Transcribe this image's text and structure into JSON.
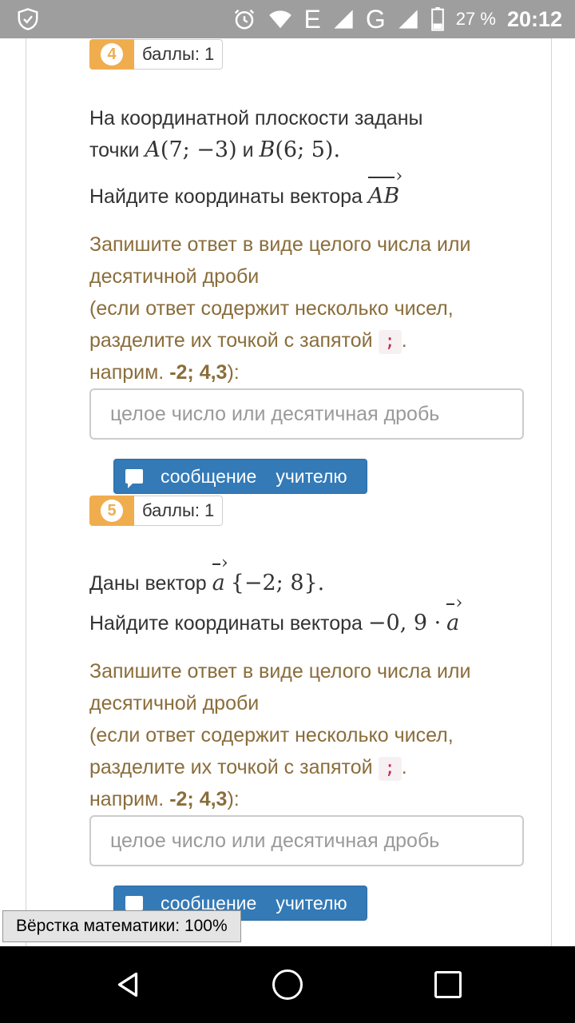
{
  "status_bar": {
    "network_letter_1": "E",
    "network_letter_2": "G",
    "battery": "27 %",
    "time": "20:12",
    "icons": [
      "shield-icon",
      "alarm-icon",
      "wifi-icon",
      "signal-icon",
      "battery-icon"
    ]
  },
  "q4": {
    "number": "4",
    "score": "баллы: 1",
    "text_1": "На координатной плоскости заданы",
    "text_2": "точки",
    "point_a_label": "A",
    "point_a_coords": "(7; −3)",
    "and": "и",
    "point_b_label": "B",
    "point_b_coords": "(6; 5).",
    "task_text": "Найдите координаты вектора",
    "task_vector": "AB"
  },
  "q5": {
    "number": "5",
    "score": "баллы: 1",
    "given_text": "Даны вектор",
    "vector_name": "a",
    "vector_coords": "{−2; 8}.",
    "task_text": "Найдите координаты вектора",
    "task_expr": "−0, 9 ·",
    "task_vector": "a"
  },
  "instructions": {
    "line_1": "Запишите ответ в виде целого числа или",
    "line_2": "десятичной дроби",
    "line_3": "(если ответ содержит несколько чисел,",
    "line_4": "разделите их точкой с запятой",
    "separator": ";",
    "dot": ".",
    "example_prefix": "наприм.",
    "example_value": "-2; 4,3",
    "example_suffix": "):"
  },
  "answer_placeholder": "целое число или десятичная дробь",
  "message_button": {
    "word_1": "сообщение",
    "word_2": "учителю"
  },
  "math_render_badge": "Вёрстка математики: 100%",
  "colors": {
    "badge_orange": "#f0ad4e",
    "button_blue": "#337ab7",
    "instruction_brown": "#8a6d3b"
  }
}
